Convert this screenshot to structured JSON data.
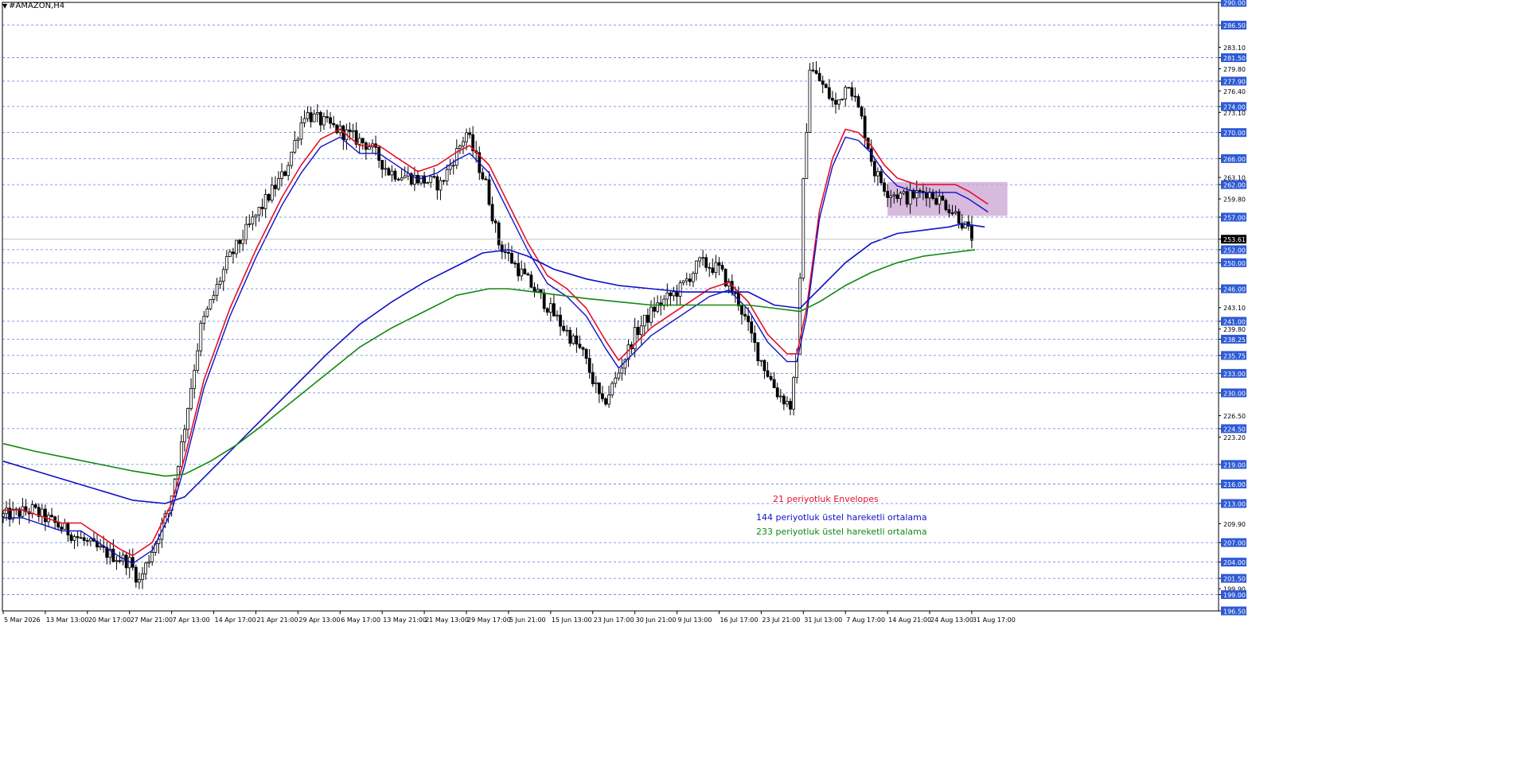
{
  "window": {
    "symbol_title": "#AMAZON,H4",
    "title_arrow": "▼"
  },
  "colors": {
    "background": "#ffffff",
    "grid": "#3b5bd6",
    "axis_label_box": "#2d5ad6",
    "candle": "#000000",
    "envelope": "#e3102a",
    "ema144": "#1010c8",
    "ema233": "#118811",
    "zone": "#c9a3d1",
    "current_price_box": "#000000"
  },
  "legend": [
    {
      "label": "21 periyotluk Envelopes",
      "color": "#e3102a"
    },
    {
      "label": "144 periyotluk üstel hareketli ortalama",
      "color": "#1010c8"
    },
    {
      "label": "233 periyotluk üstel hareketli ortalama",
      "color": "#118811"
    }
  ],
  "chart_data": {
    "type": "line",
    "symbol": "#AMAZON,H4",
    "ylim": [
      196.5,
      290.0
    ],
    "y_ticks": [
      "290.00",
      "286.50",
      "283.10",
      "281.50",
      "279.80",
      "277.90",
      "276.40",
      "274.00",
      "273.10",
      "270.00",
      "266.00",
      "263.10",
      "262.00",
      "259.80",
      "257.00",
      "253.61",
      "252.00",
      "250.00",
      "246.00",
      "243.10",
      "241.00",
      "239.80",
      "238.25",
      "235.75",
      "233.00",
      "230.00",
      "226.50",
      "224.50",
      "223.20",
      "219.00",
      "216.00",
      "213.00",
      "209.90",
      "207.00",
      "204.00",
      "201.50",
      "199.90",
      "199.00",
      "196.50"
    ],
    "highlighted_y_ticks": [
      "290.00",
      "286.50",
      "281.50",
      "277.90",
      "274.00",
      "270.00",
      "266.00",
      "262.00",
      "257.00",
      "252.00",
      "250.00",
      "246.00",
      "241.00",
      "238.25",
      "235.75",
      "233.00",
      "230.00",
      "224.50",
      "219.00",
      "216.00",
      "213.00",
      "207.00",
      "204.00",
      "201.50",
      "199.00",
      "196.50"
    ],
    "grid_levels": [
      290.0,
      286.5,
      281.5,
      277.9,
      274.0,
      270.0,
      266.0,
      262.0,
      257.0,
      252.0,
      250.0,
      246.0,
      241.0,
      238.25,
      235.75,
      233.0,
      230.0,
      224.5,
      219.0,
      216.0,
      213.0,
      207.0,
      204.0,
      201.5,
      199.0
    ],
    "current_price": 253.61,
    "x_tick_labels": [
      "5 Mar 2026",
      "13 Mar 13:00",
      "20 Mar 17:00",
      "27 Mar 21:00",
      "7 Apr 13:00",
      "14 Apr 17:00",
      "21 Apr 21:00",
      "29 Apr 13:00",
      "6 May 17:00",
      "13 May 21:00",
      "21 May 13:00",
      "29 May 17:00",
      "5 Jun 21:00",
      "15 Jun 13:00",
      "23 Jun 17:00",
      "30 Jun 21:00",
      "9 Jul 13:00",
      "16 Jul 17:00",
      "23 Jul 21:00",
      "31 Jul 13:00",
      "7 Aug 17:00",
      "14 Aug 21:00",
      "24 Aug 13:00",
      "31 Aug 17:00"
    ],
    "x_tick_bar_index": [
      0,
      13,
      26,
      39,
      52,
      65,
      78,
      91,
      104,
      117,
      130,
      143,
      156,
      169,
      182,
      195,
      208,
      221,
      234,
      247,
      260,
      273,
      286,
      299
    ],
    "bar_count": 300,
    "price_path": [
      [
        0,
        211
      ],
      [
        10,
        212
      ],
      [
        20,
        209
      ],
      [
        30,
        206
      ],
      [
        40,
        204
      ],
      [
        43,
        201
      ],
      [
        52,
        212
      ],
      [
        56,
        222
      ],
      [
        62,
        240
      ],
      [
        70,
        250
      ],
      [
        80,
        258
      ],
      [
        88,
        264
      ],
      [
        94,
        273
      ],
      [
        98,
        272
      ],
      [
        106,
        270
      ],
      [
        114,
        268
      ],
      [
        120,
        264
      ],
      [
        128,
        263
      ],
      [
        136,
        262
      ],
      [
        144,
        270
      ],
      [
        150,
        262
      ],
      [
        154,
        253
      ],
      [
        160,
        249
      ],
      [
        168,
        244
      ],
      [
        174,
        240
      ],
      [
        180,
        236
      ],
      [
        186,
        228
      ],
      [
        190,
        232
      ],
      [
        196,
        239
      ],
      [
        202,
        243
      ],
      [
        210,
        246
      ],
      [
        216,
        250
      ],
      [
        222,
        249
      ],
      [
        228,
        244
      ],
      [
        234,
        236
      ],
      [
        240,
        230
      ],
      [
        244,
        228
      ],
      [
        246,
        235
      ],
      [
        248,
        262
      ],
      [
        250,
        280
      ],
      [
        253,
        278
      ],
      [
        258,
        274
      ],
      [
        262,
        278
      ],
      [
        266,
        272
      ],
      [
        270,
        264
      ],
      [
        274,
        261
      ],
      [
        280,
        260
      ],
      [
        286,
        261
      ],
      [
        292,
        259
      ],
      [
        296,
        257
      ],
      [
        300,
        254
      ]
    ],
    "zone": {
      "x_start": 273,
      "x_end": 310,
      "y_low": 257.2,
      "y_high": 262.4
    },
    "series": [
      {
        "name": "21 periyotluk Envelopes",
        "color": "#e3102a",
        "points": [
          [
            0,
            212
          ],
          [
            6,
            212
          ],
          [
            12,
            211
          ],
          [
            18,
            210
          ],
          [
            24,
            210
          ],
          [
            30,
            208
          ],
          [
            36,
            206
          ],
          [
            40,
            205
          ],
          [
            46,
            207
          ],
          [
            52,
            213
          ],
          [
            56,
            220
          ],
          [
            62,
            232
          ],
          [
            70,
            243
          ],
          [
            78,
            252
          ],
          [
            86,
            260
          ],
          [
            92,
            265
          ],
          [
            98,
            269
          ],
          [
            104,
            270.5
          ],
          [
            110,
            268
          ],
          [
            116,
            268
          ],
          [
            122,
            266
          ],
          [
            128,
            264
          ],
          [
            134,
            265
          ],
          [
            140,
            267
          ],
          [
            144,
            268
          ],
          [
            150,
            265
          ],
          [
            156,
            259
          ],
          [
            162,
            253
          ],
          [
            168,
            248
          ],
          [
            174,
            246
          ],
          [
            180,
            243
          ],
          [
            186,
            238
          ],
          [
            190,
            235
          ],
          [
            194,
            237
          ],
          [
            200,
            240
          ],
          [
            206,
            242
          ],
          [
            212,
            244
          ],
          [
            218,
            246
          ],
          [
            224,
            247
          ],
          [
            230,
            244
          ],
          [
            236,
            239
          ],
          [
            242,
            236
          ],
          [
            245,
            236
          ],
          [
            248,
            243
          ],
          [
            252,
            258
          ],
          [
            256,
            266
          ],
          [
            260,
            270.5
          ],
          [
            264,
            270
          ],
          [
            268,
            268
          ],
          [
            272,
            265
          ],
          [
            276,
            263
          ],
          [
            282,
            262
          ],
          [
            288,
            262
          ],
          [
            294,
            262
          ],
          [
            298,
            261
          ],
          [
            304,
            259
          ]
        ]
      },
      {
        "name": "144 periyotluk üstel hareketli ortalama",
        "color": "#1010c8",
        "points": [
          [
            0,
            219.5
          ],
          [
            10,
            218
          ],
          [
            20,
            216.5
          ],
          [
            30,
            215
          ],
          [
            40,
            213.5
          ],
          [
            50,
            213
          ],
          [
            56,
            214
          ],
          [
            64,
            218
          ],
          [
            72,
            222
          ],
          [
            80,
            226
          ],
          [
            90,
            231
          ],
          [
            100,
            236
          ],
          [
            110,
            240.5
          ],
          [
            120,
            244
          ],
          [
            130,
            247
          ],
          [
            140,
            249.5
          ],
          [
            148,
            251.5
          ],
          [
            156,
            252
          ],
          [
            162,
            251
          ],
          [
            170,
            249
          ],
          [
            180,
            247.5
          ],
          [
            190,
            246.5
          ],
          [
            200,
            246
          ],
          [
            210,
            245.5
          ],
          [
            220,
            245.5
          ],
          [
            230,
            245.5
          ],
          [
            238,
            243.5
          ],
          [
            246,
            243
          ],
          [
            252,
            246
          ],
          [
            260,
            250
          ],
          [
            268,
            253
          ],
          [
            276,
            254.5
          ],
          [
            284,
            255
          ],
          [
            292,
            255.5
          ],
          [
            296,
            256
          ],
          [
            303,
            255.5
          ]
        ]
      },
      {
        "name": "233 periyotluk üstel hareketli ortalama",
        "color": "#118811",
        "points": [
          [
            0,
            222.2
          ],
          [
            10,
            221
          ],
          [
            20,
            220
          ],
          [
            30,
            219
          ],
          [
            40,
            218
          ],
          [
            50,
            217.2
          ],
          [
            56,
            217.5
          ],
          [
            64,
            219.5
          ],
          [
            72,
            222
          ],
          [
            80,
            225
          ],
          [
            90,
            229
          ],
          [
            100,
            233
          ],
          [
            110,
            237
          ],
          [
            120,
            240
          ],
          [
            130,
            242.5
          ],
          [
            140,
            245
          ],
          [
            150,
            246
          ],
          [
            156,
            246
          ],
          [
            164,
            245.5
          ],
          [
            172,
            245
          ],
          [
            180,
            244.5
          ],
          [
            190,
            244
          ],
          [
            200,
            243.5
          ],
          [
            210,
            243.5
          ],
          [
            220,
            243.5
          ],
          [
            230,
            243.5
          ],
          [
            238,
            243
          ],
          [
            246,
            242.5
          ],
          [
            252,
            244
          ],
          [
            260,
            246.5
          ],
          [
            268,
            248.5
          ],
          [
            276,
            250
          ],
          [
            284,
            251
          ],
          [
            292,
            251.5
          ],
          [
            300,
            252
          ]
        ]
      }
    ]
  }
}
